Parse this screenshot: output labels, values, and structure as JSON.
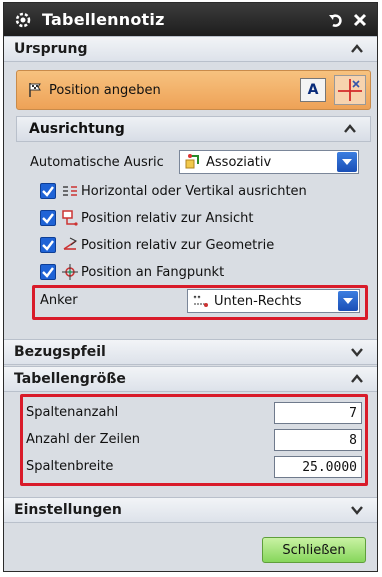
{
  "window": {
    "title": "Tabellennotiz"
  },
  "sections": {
    "ursprung": {
      "label": "Ursprung"
    },
    "bezugspfeil": {
      "label": "Bezugspfeil"
    },
    "tabellengroesse": {
      "label": "Tabellengröße"
    },
    "einstellungen": {
      "label": "Einstellungen"
    }
  },
  "position": {
    "label": "Position angeben",
    "button_a": "A"
  },
  "ausrichtung": {
    "label": "Ausrichtung",
    "auto_label": "Automatische Ausric",
    "auto_value": "Assoziativ",
    "checks": [
      {
        "label": "Horizontal oder Vertikal ausrichten",
        "checked": true,
        "icon": "align-lines-icon"
      },
      {
        "label": "Position relativ zur Ansicht",
        "checked": true,
        "icon": "view-relative-icon"
      },
      {
        "label": "Position relativ zur Geometrie",
        "checked": true,
        "icon": "geometry-relative-icon"
      },
      {
        "label": "Position an Fangpunkt",
        "checked": true,
        "icon": "snap-point-icon"
      }
    ],
    "anker_label": "Anker",
    "anker_value": "Unten-Rechts"
  },
  "table_size": {
    "spaltenanzahl_label": "Spaltenanzahl",
    "spaltenanzahl_value": "7",
    "zeilen_label": "Anzahl der Zeilen",
    "zeilen_value": "8",
    "spaltenbreite_label": "Spaltenbreite",
    "spaltenbreite_value": "25.0000"
  },
  "buttons": {
    "close": "Schließen"
  },
  "colors": {
    "accent_red": "#d91b2a",
    "checkbox_blue": "#1f63d6",
    "orange_bar": "#eea257",
    "green_button": "#86d65b"
  }
}
